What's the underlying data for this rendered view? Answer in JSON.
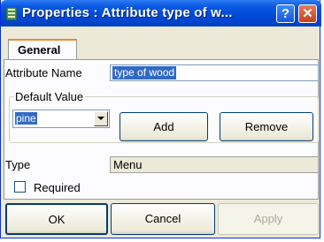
{
  "window": {
    "title": "Properties : Attribute type of w...",
    "help_label": "?",
    "close_label": "✕"
  },
  "tabs": [
    {
      "label": "General",
      "active": true
    }
  ],
  "form": {
    "attribute_name_label": "Attribute Name",
    "attribute_name_value": "type of wood",
    "default_value_group_label": "Default Value",
    "default_value_selected": "pine",
    "add_label": "Add",
    "remove_label": "Remove",
    "type_label": "Type",
    "type_value": "Menu",
    "required_label": "Required",
    "required_checked": false
  },
  "footer": {
    "ok_label": "OK",
    "cancel_label": "Cancel",
    "apply_label": "Apply"
  },
  "colors": {
    "titlebar": "#0049d8",
    "selection": "#316ac5",
    "dialog_bg": "#ece9d8",
    "close_button": "#c4401a"
  }
}
